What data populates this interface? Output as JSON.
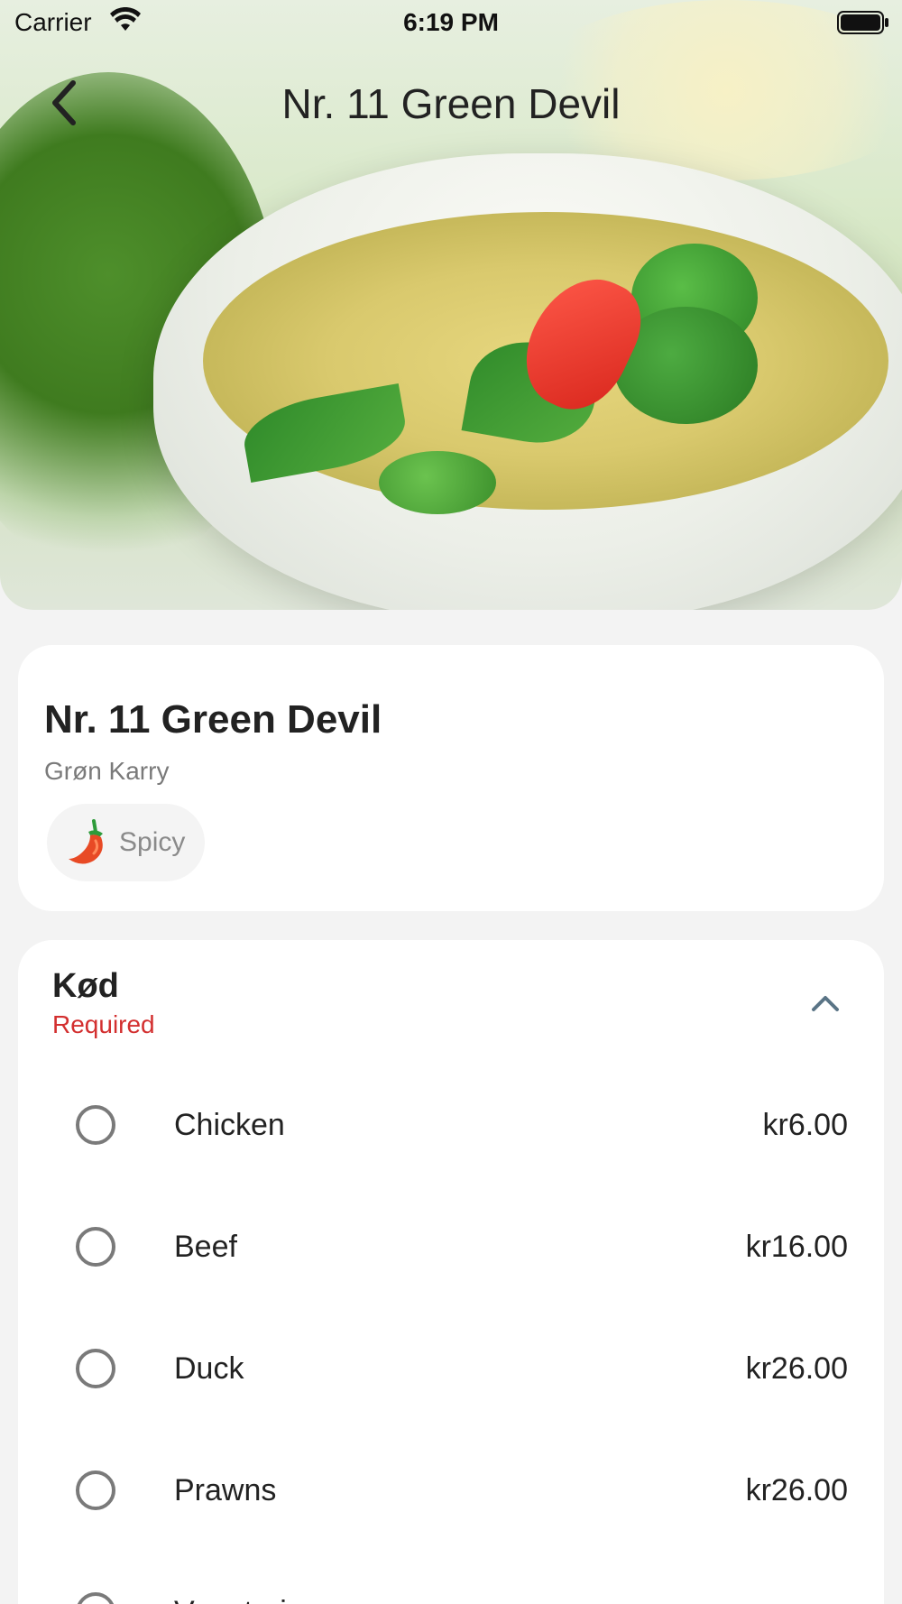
{
  "status_bar": {
    "carrier": "Carrier",
    "time": "6:19 PM",
    "wifi_icon": "wifi-icon",
    "battery_icon": "battery-full-icon"
  },
  "nav": {
    "title": "Nr. 11 Green Devil",
    "back_icon": "chevron-left-icon"
  },
  "item": {
    "name": "Nr. 11 Green Devil",
    "subtitle": "Grøn Karry",
    "tags": [
      {
        "label": "Spicy",
        "icon": "chili-pepper-icon"
      }
    ]
  },
  "option_group": {
    "title": "Kød",
    "required_label": "Required",
    "collapse_icon": "chevron-up-icon",
    "options": [
      {
        "label": "Chicken",
        "price": "kr6.00",
        "selected": false
      },
      {
        "label": "Beef",
        "price": "kr16.00",
        "selected": false
      },
      {
        "label": "Duck",
        "price": "kr26.00",
        "selected": false
      },
      {
        "label": "Prawns",
        "price": "kr26.00",
        "selected": false
      },
      {
        "label": "Vegetarian",
        "price": "",
        "selected": false
      }
    ]
  },
  "colors": {
    "background": "#f3f3f3",
    "card": "#ffffff",
    "required": "#d32f2f",
    "collapse_icon": "#5a7486",
    "radio_border": "#7a7a7a"
  }
}
